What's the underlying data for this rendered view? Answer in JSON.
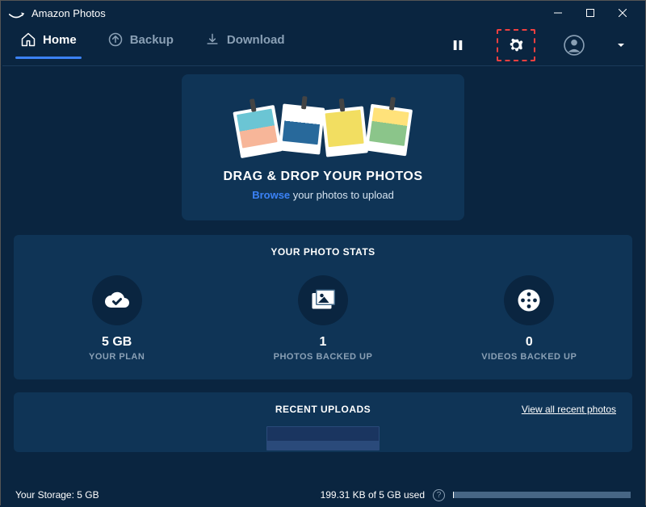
{
  "titlebar": {
    "app_name": "Amazon Photos"
  },
  "nav": {
    "tabs": [
      {
        "label": "Home",
        "active": true
      },
      {
        "label": "Backup",
        "active": false
      },
      {
        "label": "Download",
        "active": false
      }
    ]
  },
  "dropzone": {
    "title": "DRAG & DROP YOUR PHOTOS",
    "browse": "Browse",
    "sub_rest": " your photos to upload"
  },
  "stats": {
    "title": "YOUR PHOTO STATS",
    "items": [
      {
        "value": "5 GB",
        "label": "YOUR PLAN"
      },
      {
        "value": "1",
        "label": "PHOTOS BACKED UP"
      },
      {
        "value": "0",
        "label": "VIDEOS BACKED UP"
      }
    ]
  },
  "recent": {
    "title": "RECENT UPLOADS",
    "view_all": "View all recent photos"
  },
  "footer": {
    "storage_label": "Your Storage: 5 GB",
    "usage_text": "199.31 KB of 5 GB used"
  }
}
